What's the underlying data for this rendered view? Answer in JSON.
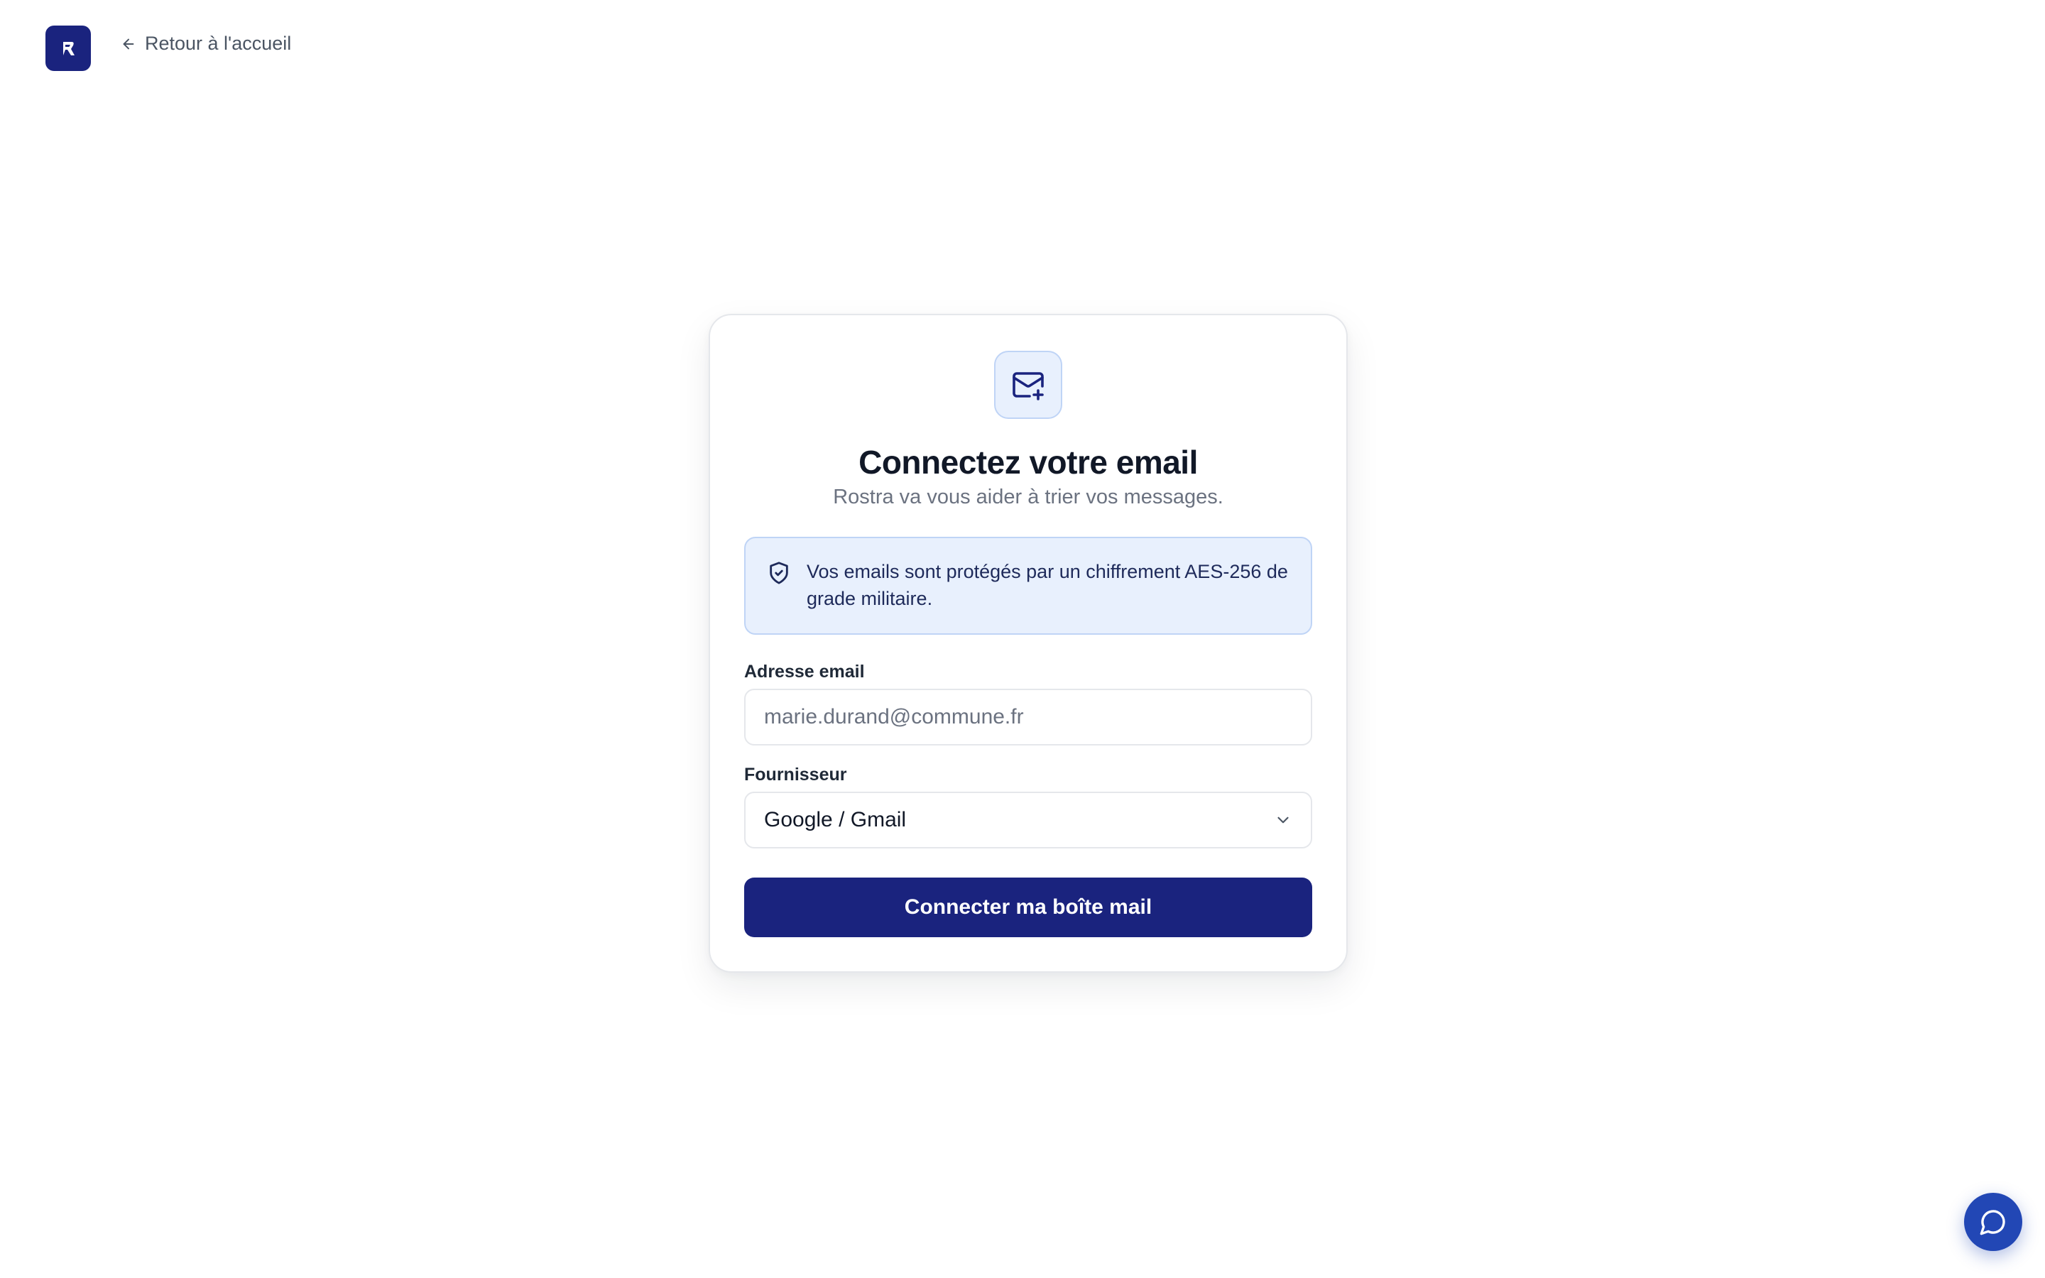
{
  "header": {
    "logo_letter": "R",
    "back_label": "Retour à l'accueil"
  },
  "card": {
    "icon": "mail-plus-icon",
    "title": "Connectez votre email",
    "subtitle": "Rostra va vous aider à trier vos messages.",
    "notice": {
      "icon": "shield-check-icon",
      "text": "Vos emails sont protégés par un chiffrement AES-256 de grade militaire."
    },
    "email_field": {
      "label": "Adresse email",
      "value": "",
      "placeholder": "marie.durand@commune.fr"
    },
    "provider_field": {
      "label": "Fournisseur",
      "selected": "Google / Gmail"
    },
    "submit_label": "Connecter ma boîte mail"
  },
  "chat_button": {
    "icon": "chat-bubble-icon"
  },
  "colors": {
    "brand": "#1a237e",
    "notice_bg": "#e8f0fd",
    "notice_border": "#bfd4f6",
    "chat_fab": "#2247b5"
  }
}
